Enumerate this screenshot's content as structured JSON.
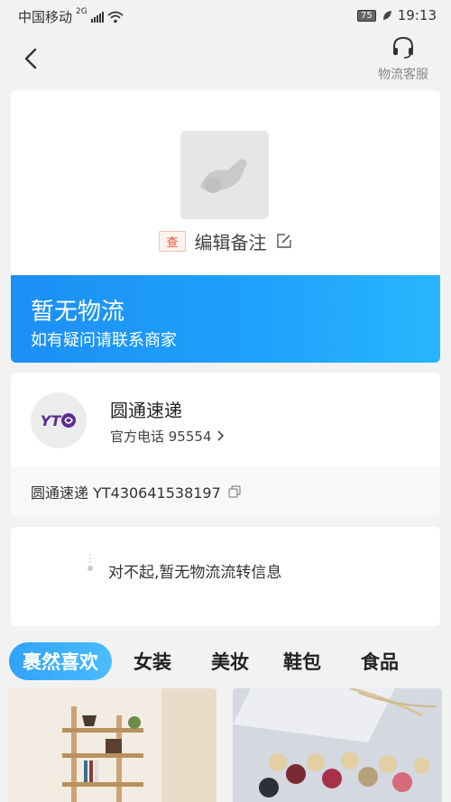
{
  "status_bar": {
    "carrier": "中国移动",
    "network": "2G",
    "battery": "75",
    "time": "19:13"
  },
  "nav": {
    "support_label": "物流客服"
  },
  "package": {
    "query_tag": "查",
    "note_label": "编辑备注"
  },
  "banner": {
    "title": "暂无物流",
    "subtitle": "如有疑问请联系商家",
    "color": "#1e96f7"
  },
  "carrier": {
    "logo_text": "YT",
    "name": "圆通速递",
    "phone": "官方电话 95554",
    "tracking": "圆通速递 YT430641538197"
  },
  "info": {
    "message": "对不起,暂无物流流转信息"
  },
  "tabs": [
    {
      "label": "裹然喜欢",
      "active": true
    },
    {
      "label": "女装",
      "active": false
    },
    {
      "label": "美妆",
      "active": false
    },
    {
      "label": "鞋包",
      "active": false
    },
    {
      "label": "食品",
      "active": false
    }
  ],
  "products": [
    {
      "icon": "shelf-photo"
    },
    {
      "icon": "earrings-photo"
    }
  ]
}
